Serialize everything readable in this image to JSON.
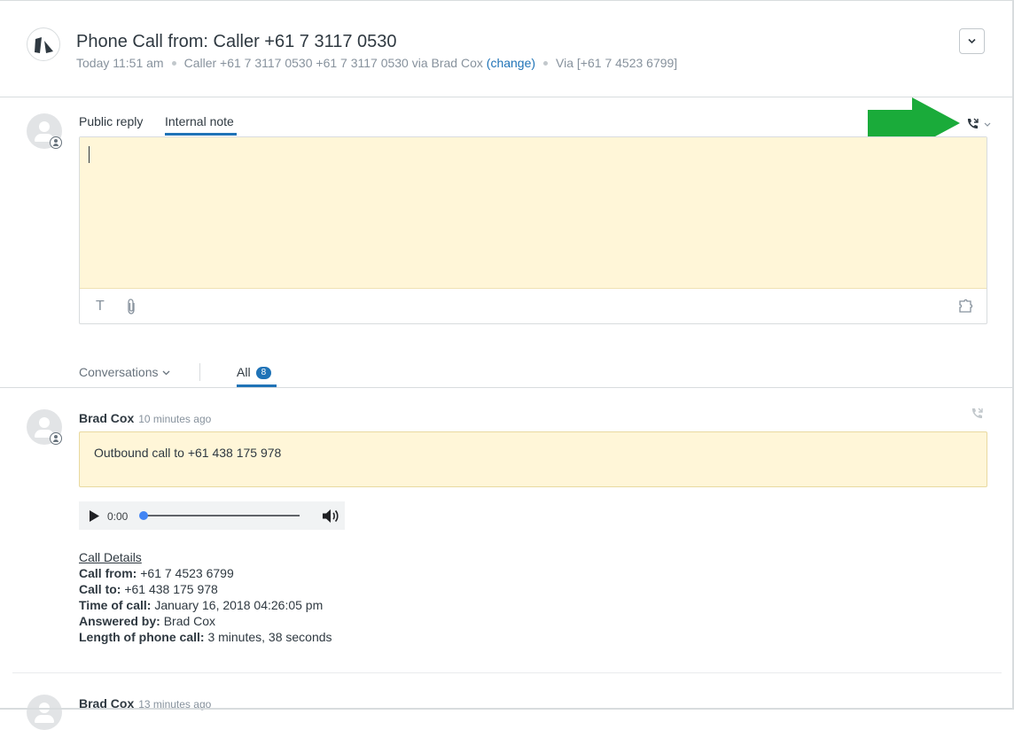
{
  "header": {
    "title": "Phone Call from: Caller +61 7 3117 0530",
    "time": "Today 11:51 am",
    "caller_prefix": "Caller +61 7 3117 0530 +61 7 3117 0530 via Brad Cox",
    "change_link": "(change)",
    "via": "Via [+61 7 4523 6799]"
  },
  "composer": {
    "tabs": [
      {
        "label": "Public reply",
        "active": false
      },
      {
        "label": "Internal note",
        "active": true
      }
    ],
    "editor_value": "",
    "toolbar_icons": [
      "text-format-icon",
      "attachment-icon",
      "apps-icon"
    ],
    "channel_icon": "phone-call-icon"
  },
  "filter": {
    "conversations_label": "Conversations",
    "all_label": "All",
    "all_count": "8"
  },
  "events": [
    {
      "author": "Brad Cox",
      "ago": "10 minutes ago",
      "note": "Outbound call to +61 438 175 978",
      "audio": {
        "time": "0:00",
        "progress": 0
      },
      "details": {
        "heading": "Call Details",
        "rows": [
          {
            "label": "Call from:",
            "value": "+61 7 4523 6799"
          },
          {
            "label": "Call to:",
            "value": "+61 438 175 978"
          },
          {
            "label": "Time of call:",
            "value": "January 16, 2018 04:26:05 pm"
          },
          {
            "label": "Answered by:",
            "value": "Brad Cox"
          },
          {
            "label": "Length of phone call:",
            "value": "3 minutes, 38 seconds"
          }
        ]
      }
    },
    {
      "author": "Brad Cox",
      "ago": "13 minutes ago"
    }
  ],
  "colors": {
    "accent": "#1f73b7",
    "note_background": "#fff6d8",
    "arrow": "#1aab3a"
  }
}
